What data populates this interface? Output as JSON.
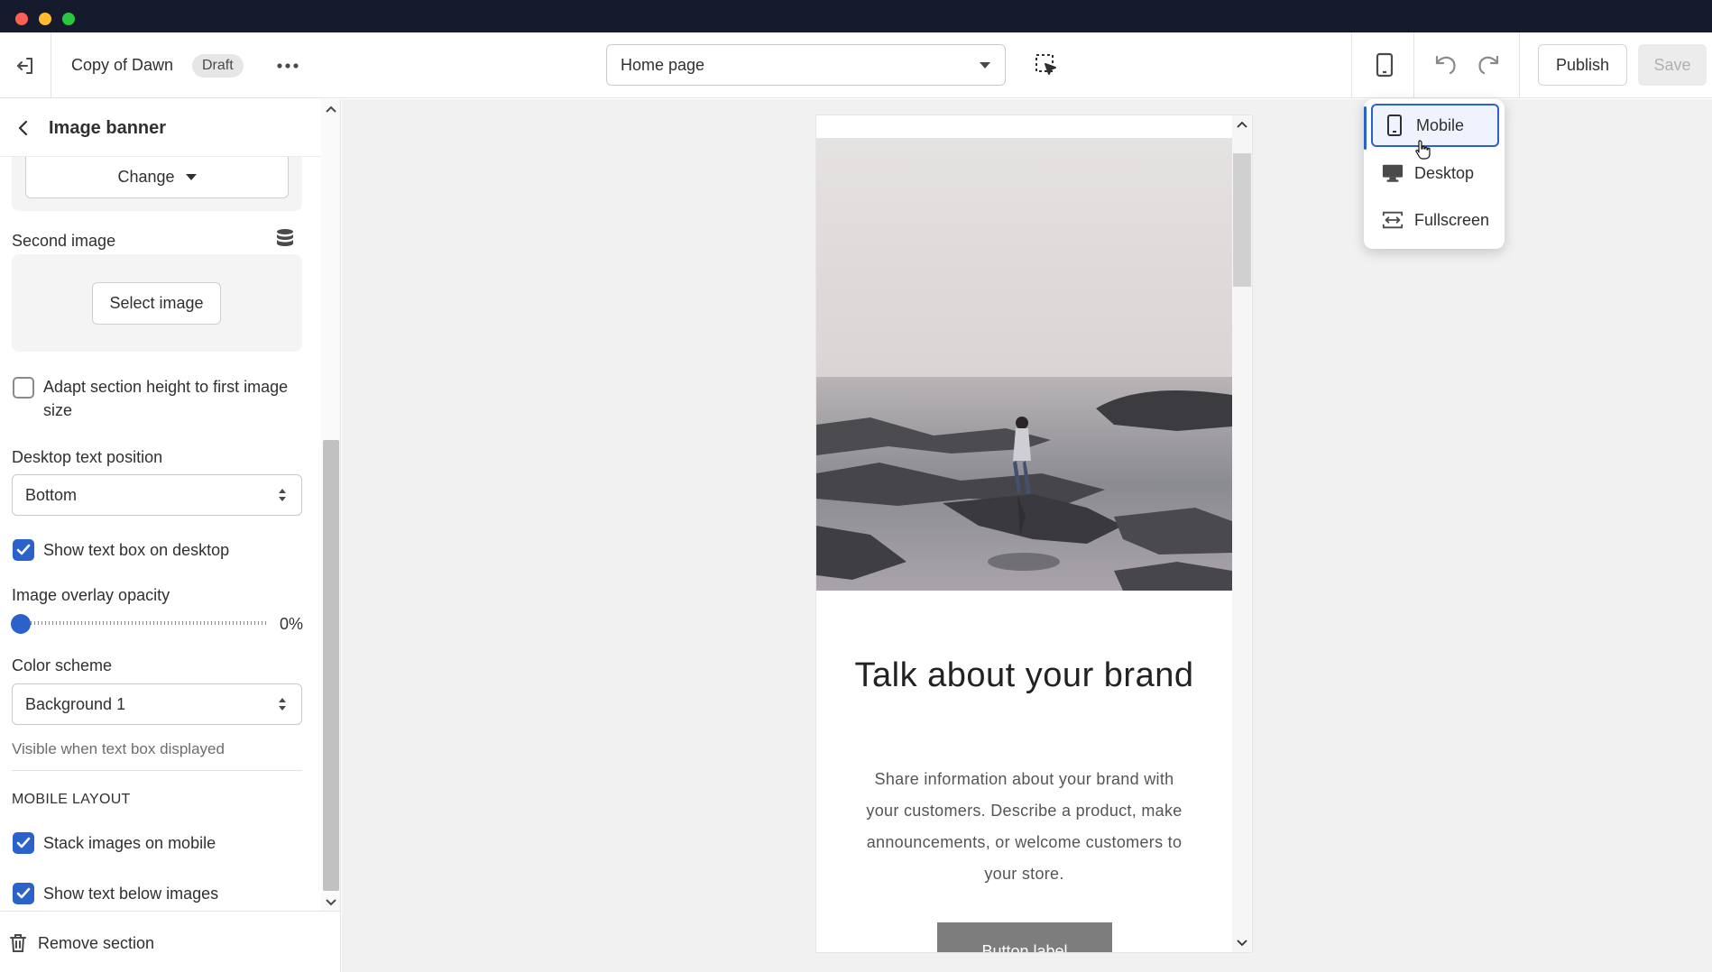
{
  "window": {
    "traffic_lights": [
      "#fe5f57",
      "#febc2e",
      "#28c840"
    ]
  },
  "topbar": {
    "exit_icon": "exit-icon",
    "theme_name": "Copy of Dawn",
    "status_badge": "Draft",
    "more_icon": "ellipsis-icon",
    "page_select": "Home page",
    "inspector_icon": "select-inspect-icon",
    "device_icon": "mobile-device-icon",
    "undo_icon": "undo-icon",
    "redo_icon": "redo-icon",
    "publish_label": "Publish",
    "save_label": "Save"
  },
  "sidebar": {
    "title": "Image banner",
    "change_label": "Change",
    "second_image_label": "Second image",
    "select_image_label": "Select image",
    "adapt_height_label": "Adapt section height to first image size",
    "adapt_height_checked": false,
    "desktop_text_position_label": "Desktop text position",
    "desktop_text_position_value": "Bottom",
    "show_text_box_label": "Show text box on desktop",
    "show_text_box_checked": true,
    "overlay_opacity_label": "Image overlay opacity",
    "overlay_opacity_value": "0%",
    "overlay_opacity_fraction": 0,
    "color_scheme_label": "Color scheme",
    "color_scheme_value": "Background 1",
    "color_scheme_help": "Visible when text box displayed",
    "mobile_layout_heading": "MOBILE LAYOUT",
    "stack_images_label": "Stack images on mobile",
    "stack_images_checked": true,
    "show_text_below_label": "Show text below images",
    "show_text_below_checked": true,
    "remove_section_label": "Remove section"
  },
  "preview": {
    "heading": "Talk about your brand",
    "body": "Share information about your brand with your customers. Describe a product, make announcements, or welcome customers to your store.",
    "button_label": "Button label"
  },
  "device_menu": {
    "items": [
      {
        "label": "Mobile",
        "icon": "mobile-icon",
        "selected": true
      },
      {
        "label": "Desktop",
        "icon": "desktop-icon",
        "selected": false
      },
      {
        "label": "Fullscreen",
        "icon": "fullscreen-icon",
        "selected": false
      }
    ]
  },
  "colors": {
    "accent": "#2a62c9",
    "os_bar": "#151b2c",
    "canvas": "#f1f1f1",
    "preview_button": "#7d7d7d"
  }
}
